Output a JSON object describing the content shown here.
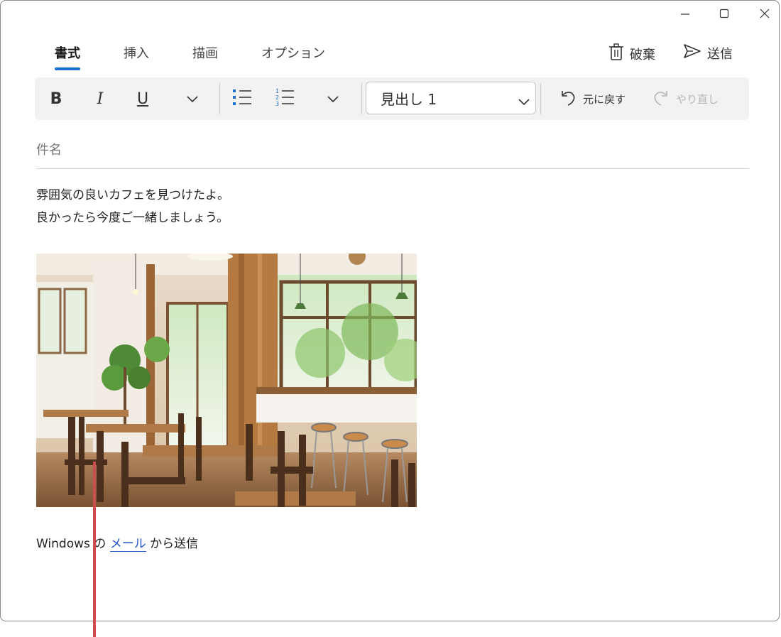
{
  "tabs": [
    {
      "label": "書式",
      "active": true
    },
    {
      "label": "挿入",
      "active": false
    },
    {
      "label": "描画",
      "active": false
    },
    {
      "label": "オプション",
      "active": false
    }
  ],
  "actions": {
    "discard": "破棄",
    "send": "送信"
  },
  "toolbar": {
    "bold": "B",
    "italic": "I",
    "underline": "U",
    "heading_value": "見出し 1",
    "undo": "元に戻す",
    "redo": "やり直し"
  },
  "subject": {
    "placeholder": "件名"
  },
  "body": {
    "lines": [
      "雰囲気の良いカフェを見つけたよ。",
      "良かったら今度ご一緒しましょう。"
    ]
  },
  "signature": {
    "prefix": "Windows の ",
    "link": "メール",
    "suffix": " から送信"
  },
  "colors": {
    "accent": "#1a6fd1",
    "link": "#2255cc",
    "marker": "#cc4e4e",
    "toolbar_bg": "#f2f2f2"
  },
  "icons": [
    "minimize-icon",
    "maximize-icon",
    "close-icon",
    "trash-icon",
    "send-icon",
    "chevron-down-icon",
    "bullet-list-icon",
    "numbered-list-icon",
    "undo-icon",
    "redo-icon"
  ]
}
